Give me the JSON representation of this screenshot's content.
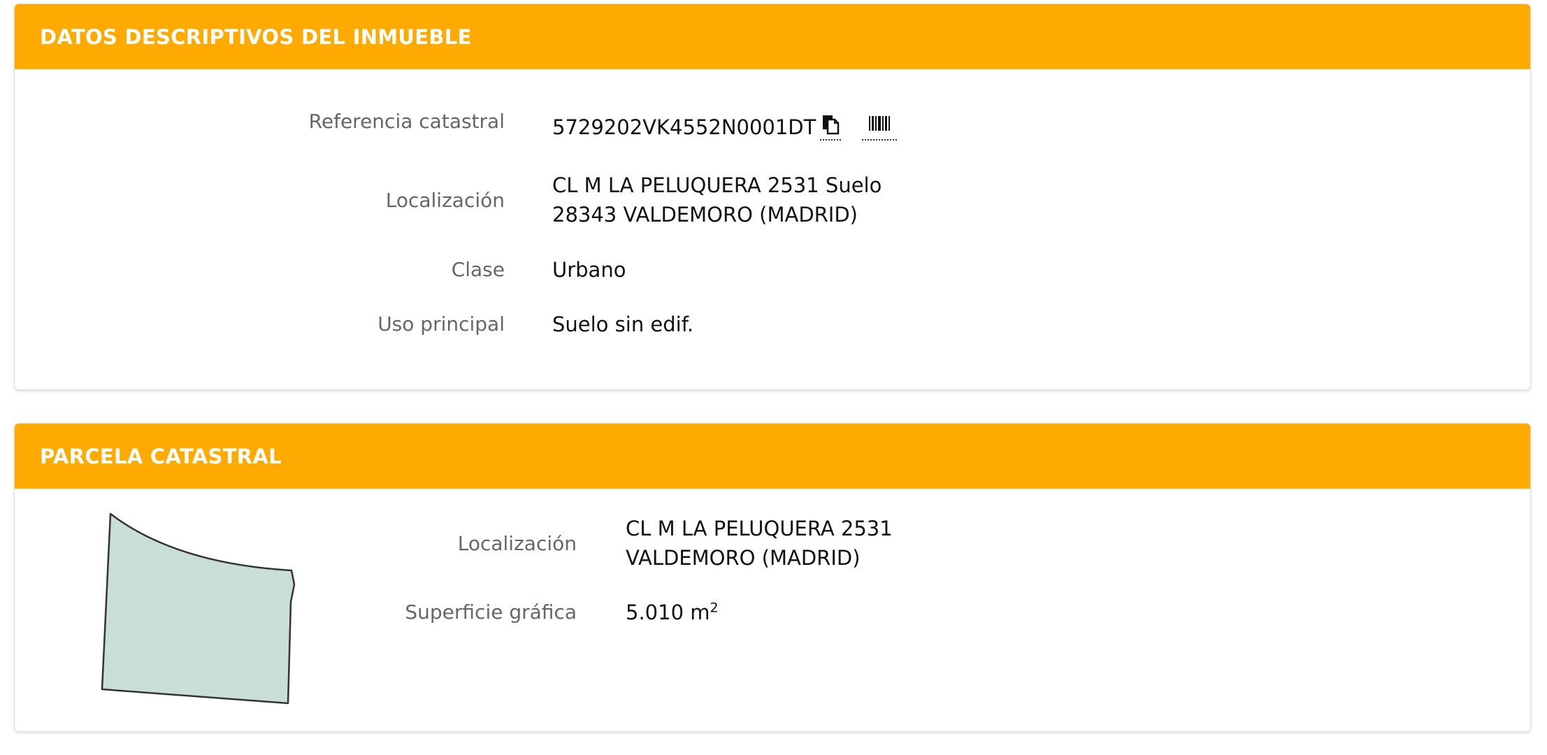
{
  "inmueble": {
    "title": "DATOS DESCRIPTIVOS DEL INMUEBLE",
    "referencia": {
      "label": "Referencia catastral",
      "value": "5729202VK4552N0001DT"
    },
    "localizacion": {
      "label": "Localización",
      "line1": "CL M LA PELUQUERA 2531 Suelo",
      "line2": "28343 VALDEMORO (MADRID)"
    },
    "clase": {
      "label": "Clase",
      "value": "Urbano"
    },
    "uso": {
      "label": "Uso principal",
      "value": "Suelo sin edif."
    }
  },
  "parcela": {
    "title": "PARCELA CATASTRAL",
    "localizacion": {
      "label": "Localización",
      "line1": "CL M LA PELUQUERA 2531",
      "line2": "VALDEMORO (MADRID)"
    },
    "superficie": {
      "label": "Superficie gráfica",
      "value": "5.010 m",
      "unit_exp": "2"
    }
  },
  "icons": {
    "copy": "copy-icon",
    "barcode": "barcode-icon",
    "parcel": "parcel-shape-icon"
  },
  "colors": {
    "header": "#ffaa00",
    "parcel_fill": "#c8ded7",
    "parcel_stroke": "#333333",
    "label": "#666666"
  }
}
